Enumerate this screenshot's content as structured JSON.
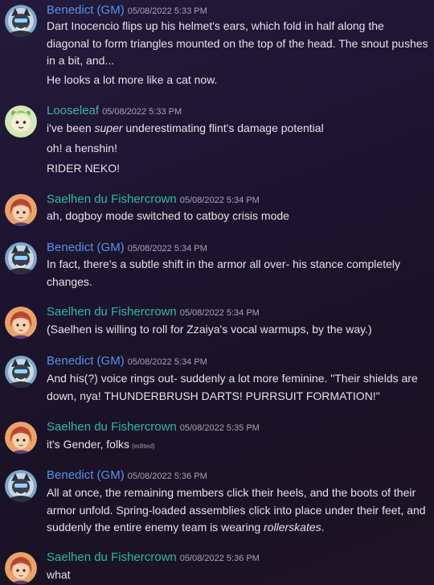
{
  "colors": {
    "gm": "#5b8fe6",
    "looseleaf": "#3fb39a",
    "saelhen": "#2fb8a3",
    "text": "#e3e2e8",
    "timestamp": "#a7a3b3"
  },
  "messages": [
    {
      "author": "Benedict (GM)",
      "timestamp": "05/08/2022 5:33 PM",
      "lines": [
        "Dart Inocencio flips up his helmet's ears, which fold in half along the diagonal to form triangles mounted on the top of the head. The snout pushes in a bit, and...",
        "He looks a lot more like a cat now."
      ]
    },
    {
      "author": "Looseleaf",
      "timestamp": "05/08/2022 5:33 PM",
      "lines": [
        {
          "pre": "i've been ",
          "em": "super",
          "post": " underestimating flint's damage potential"
        },
        "oh! a henshin!",
        "RIDER NEKO!"
      ]
    },
    {
      "author": "Saelhen du Fishercrown",
      "timestamp": "05/08/2022 5:34 PM",
      "lines": [
        "ah, dogboy mode switched to catboy crisis mode"
      ]
    },
    {
      "author": "Benedict (GM)",
      "timestamp": "05/08/2022 5:34 PM",
      "lines": [
        "In fact, there's a subtle shift in the armor all over- his stance completely changes."
      ]
    },
    {
      "author": "Saelhen du Fishercrown",
      "timestamp": "05/08/2022 5:34 PM",
      "lines": [
        "(Saelhen is willing to roll for Zzaiya's vocal warmups, by the way.)"
      ]
    },
    {
      "author": "Benedict (GM)",
      "timestamp": "05/08/2022 5:34 PM",
      "lines": [
        "And his(?) voice rings out- suddenly a lot more feminine. \"Their shields are down, nya! THUNDERBRUSH DARTS! PURRSUIT FORMATION!\""
      ]
    },
    {
      "author": "Saelhen du Fishercrown",
      "timestamp": "05/08/2022 5:35 PM",
      "lines": [
        "it's Gender, folks"
      ],
      "edited": "(edited)"
    },
    {
      "author": "Benedict (GM)",
      "timestamp": "05/08/2022 5:36 PM",
      "lines": [
        {
          "pre": "All at once, the remaining members click their heels, and the boots of their armor unfold. Spring-loaded assemblies click into place under their feet, and suddenly the entire enemy team is wearing ",
          "em": "rollerskates",
          "post": "."
        }
      ]
    },
    {
      "author": "Saelhen du Fishercrown",
      "timestamp": "05/08/2022 5:36 PM",
      "lines": [
        "what"
      ]
    }
  ]
}
